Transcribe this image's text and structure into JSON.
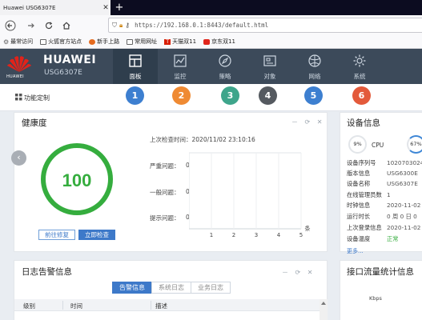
{
  "browser": {
    "tab_title": "Huawei USG6307E",
    "url": "https://192.168.0.1:8443/default.html",
    "bookmarks": [
      "最常访问",
      "火狐官方站点",
      "新手上路",
      "常用网址",
      "天猫双11",
      "京东双11"
    ]
  },
  "app": {
    "brand": "HUAWEI",
    "logo_text": "HUAWEI",
    "model": "USG6307E",
    "menu": [
      {
        "label": "面板",
        "icon": "dashboard-icon",
        "active": true
      },
      {
        "label": "监控",
        "icon": "monitor-icon",
        "active": false
      },
      {
        "label": "策略",
        "icon": "policy-compass-icon",
        "active": false
      },
      {
        "label": "对象",
        "icon": "object-icon",
        "active": false
      },
      {
        "label": "网络",
        "icon": "network-globe-icon",
        "active": false
      },
      {
        "label": "系统",
        "icon": "system-gear-icon",
        "active": false
      }
    ],
    "func_label": "功能定制",
    "step_numbers": [
      {
        "n": "1",
        "color": "#3d7fd0"
      },
      {
        "n": "2",
        "color": "#ef8a33"
      },
      {
        "n": "3",
        "color": "#3ea58b"
      },
      {
        "n": "4",
        "color": "#555a60"
      },
      {
        "n": "5",
        "color": "#3d7fd0"
      },
      {
        "n": "6",
        "color": "#e35a3b"
      }
    ]
  },
  "health": {
    "title": "健康度",
    "score": "100",
    "last_check_label": "上次检查时间：",
    "last_check_time": "2020/11/02 23:10:16",
    "risks": [
      {
        "label": "严重问题：",
        "value": "0"
      },
      {
        "label": "一般问题：",
        "value": "0"
      },
      {
        "label": "提示问题：",
        "value": "0"
      }
    ],
    "buttons": {
      "fix": "前往修复",
      "check": "立即检查"
    },
    "tools": "－ ⟳ ✕"
  },
  "chart_data": {
    "type": "bar",
    "categories": [
      "1",
      "2",
      "3",
      "4",
      "5"
    ],
    "xlabel": "条",
    "series": [],
    "xlim": [
      0,
      5
    ]
  },
  "device": {
    "title": "设备信息",
    "cpu_percent": "9%",
    "cpu_label": "CPU",
    "mem_percent": "67%",
    "rows": [
      {
        "key": "设备序列号",
        "value": "1020703024"
      },
      {
        "key": "版本信息",
        "value": "USG6300E"
      },
      {
        "key": "设备名称",
        "value": "USG6307E"
      },
      {
        "key": "在线管理员数",
        "value": "1"
      },
      {
        "key": "时钟信息",
        "value": "2020-11-02"
      },
      {
        "key": "运行时长",
        "value": "0 周 0 日 0"
      },
      {
        "key": "上次登录信息",
        "value": "2020-11-02"
      },
      {
        "key": "设备温度",
        "value": "正常"
      }
    ],
    "more": "更多..."
  },
  "log": {
    "title": "日志告警信息",
    "tabs": [
      "告警信息",
      "系统日志",
      "业务日志"
    ],
    "columns": [
      "级别",
      "时间",
      "描述"
    ],
    "tools": "－ ⟳ ✕"
  },
  "traffic": {
    "title": "接口流量统计信息",
    "unit": "Kbps"
  }
}
